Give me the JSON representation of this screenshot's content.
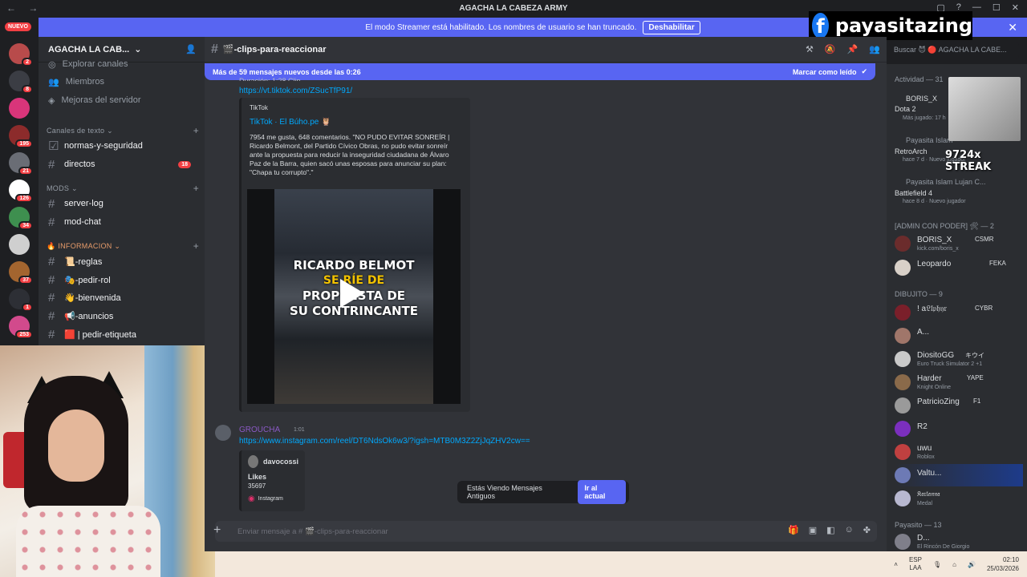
{
  "window": {
    "title": "AGACHA LA CABEZA ARMY"
  },
  "streamer_banner": {
    "text": "El modo Streamer está habilitado. Los nombres de usuario se han truncado.",
    "button": "Deshabilitar"
  },
  "overlay": {
    "facebook_name": "payasitazing",
    "streak": "9724x STREAK"
  },
  "servers": {
    "new_label": "NUEVO",
    "badges": [
      "2",
      "8",
      "195",
      "21",
      "126",
      "34",
      "37",
      "1",
      "253"
    ]
  },
  "sidebar": {
    "server_name": "AGACHA LA CAB...",
    "top_items": [
      "Explorar canales",
      "Miembros",
      "Mejoras del servidor"
    ],
    "categories": {
      "text": "Canales de texto",
      "mods": "MODS",
      "info": "INFORMACION"
    },
    "channels_text": [
      {
        "name": "normas-y-seguridad"
      },
      {
        "name": "directos",
        "badge": "18"
      }
    ],
    "channels_mods": [
      {
        "name": "server-log"
      },
      {
        "name": "mod-chat"
      }
    ],
    "channels_info": [
      {
        "name": "📜-reglas"
      },
      {
        "name": "🎭-pedir-rol"
      },
      {
        "name": "👋-bienvenida"
      },
      {
        "name": "📢-anuncios"
      },
      {
        "name": "🟥 | pedir-etiqueta"
      }
    ]
  },
  "chat": {
    "channel_name": "🎬-clips-para-reaccionar",
    "new_messages": "Más de 59 mensajes nuevos desde las 0:26",
    "mark_read": "Marcar como leído",
    "partial_line": "Duración: 1:28 Clip",
    "link1": "https://vt.tiktok.com/ZSucTfP91/",
    "embed": {
      "provider": "TikTok",
      "title": "TikTok · El Búho.pe 🦉",
      "description": "7954 me gusta, 648 comentarios. \"NO PUDO EVITAR SONREÍR | Ricardo Belmont, del Partido Cívico Obras, no pudo evitar sonreír ante la propuesta para reducir la inseguridad ciudadana de Álvaro Paz de la Barra, quien sacó unas esposas para anunciar su plan: \"Chapa tu corrupto\".\"",
      "video_line1": "RICARDO BELMOT",
      "video_line2": "SE RÍE DE",
      "video_line3": "PROPUESTA DE",
      "video_line4": "SU CONTRINCANTE"
    },
    "msg2": {
      "user": "GROUCHA",
      "time": "1:01",
      "link": "https://www.instagram.com/reel/DT6NdsOk6w3/?igsh=MTB0M3Z2ZjJqZHV2cw==",
      "ig_user": "davocossi",
      "ig_likes_label": "Likes",
      "ig_likes": "35697",
      "ig_provider": "Instagram"
    },
    "toast": {
      "text": "Estás Viendo Mensajes Antiguos",
      "button": "Ir al actual"
    },
    "input_placeholder": "Enviar mensaje a # 🎬-clips-para-reaccionar"
  },
  "search": {
    "placeholder": "Buscar 😈 🔴 AGACHA LA CABE..."
  },
  "members": {
    "activity_header": "Actividad — 31",
    "activity": [
      {
        "name": "BORIS_X",
        "game": "Dota 2",
        "detail": "Más jugado: 17 h"
      },
      {
        "name": "Payasita Islam",
        "game": "RetroArch",
        "detail": "hace 7 d · Nuevo jugador"
      },
      {
        "name": "Payasita Islam Lujan C...",
        "game": "Battlefield 4",
        "detail": "hace 8 d · Nuevo jugador"
      }
    ],
    "admin_header": "[ADMIN CON PODER] 🛠 — 2",
    "admins": [
      {
        "name": "BORIS_X",
        "tag": "CSMR",
        "status": "kick.com/boris_x"
      },
      {
        "name": "Leopardo",
        "tag": "FEKA",
        "status": ""
      }
    ],
    "dibujito_header": "DIBUJITO — 9",
    "dibujitos": [
      {
        "name": "! a𝔏𝔩𝔭𝔥𝔶𝔯",
        "tag": "CYBR",
        "status": ""
      },
      {
        "name": "A...",
        "tag": "",
        "status": ""
      },
      {
        "name": "DiositoGG",
        "tag": "キウイ",
        "status": "Euro Truck Simulator 2 +1"
      },
      {
        "name": "Harder",
        "tag": "YAPE",
        "status": "Knight Online"
      },
      {
        "name": "PatricioZing",
        "tag": "F1",
        "status": ""
      },
      {
        "name": "R2",
        "tag": "",
        "status": ""
      },
      {
        "name": "uwu",
        "tag": "",
        "status": "Roblox"
      },
      {
        "name": "Valtu...",
        "tag": "",
        "status": ""
      },
      {
        "name": "𝔎𝔞𝔯𝔩𝔞𝔫𝔫𝔞",
        "tag": "",
        "status": "Medal"
      }
    ],
    "payasito_header": "Payasito — 13",
    "payasito": [
      {
        "name": "D...",
        "status": "El Rincón De Giorgio"
      }
    ]
  },
  "taskbar": {
    "lang1": "ESP",
    "lang2": "LAA",
    "time": "02:10",
    "date": "25/03/2026"
  },
  "colors": {
    "accent": "#5865f2",
    "link": "#00a8fc",
    "badge": "#f23f43"
  }
}
